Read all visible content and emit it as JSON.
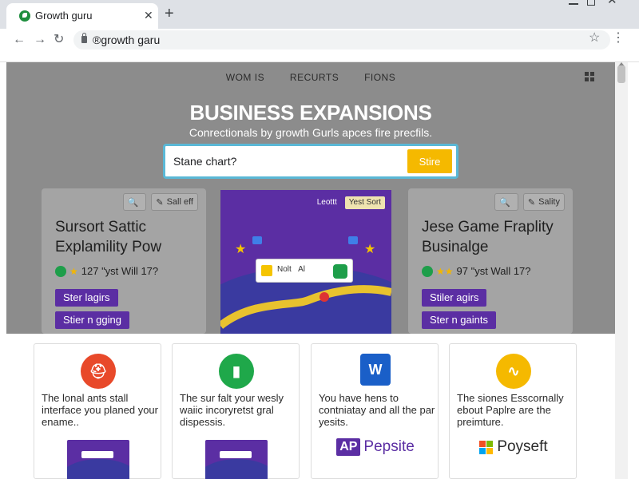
{
  "browser": {
    "tab_title": "Growth guru",
    "tab_close": "✕",
    "new_tab": "+",
    "url": "®growth garu",
    "nav_back": "←",
    "nav_forward": "→",
    "nav_reload": "↻",
    "star": "☆",
    "menu": "⋮"
  },
  "nav": {
    "items": [
      "WOM IS",
      "RECURTS",
      "FIONS"
    ]
  },
  "hero": {
    "title": "BUSINESS EXPANSIONS",
    "subtitle": "Conrectionals by growth Gurls apces fire precfils.",
    "search_value": "Stane chart?",
    "search_button": "Stire"
  },
  "cards": {
    "left": {
      "search_icon": "🔍",
      "action_label": "Sall eff",
      "title": "Sursort Sattic Explamility Pow",
      "meta": "127 \"yst Will 17?",
      "pill_1": "Ster lagirs",
      "pill_2": "Stier n gging"
    },
    "middle": {
      "btn_1": "Leottt",
      "btn_2": "Yest Sort",
      "dialog_text": "Nolt   Al"
    },
    "right": {
      "search_icon": "🔍",
      "action_label": "Sality",
      "title": "Jese Game Fraplity Businalge",
      "meta": "97 \"yst Wall 17?",
      "pill_1": "Stiler agirs",
      "pill_2": "Ster n gaints"
    }
  },
  "features": [
    {
      "icon": "⛑",
      "text": "The lonal ants stall interface you planed your ename.."
    },
    {
      "icon": "▮",
      "text": "The sur falt your wesly waiic incoryretst gral dispessis."
    },
    {
      "icon": "W",
      "text": "You have hens to contniatay and all the par yesits.",
      "brand_badge": "AP",
      "brand_name": "Pepsite"
    },
    {
      "icon": "∿",
      "text": "The siones Esscornally ebout Paplre are the preimture.",
      "brand_name": "Poyseft"
    }
  ],
  "colors": {
    "accent_purple": "#5b2ea3",
    "search_button": "#f5b900",
    "hero_bg": "#8c8c8c"
  }
}
